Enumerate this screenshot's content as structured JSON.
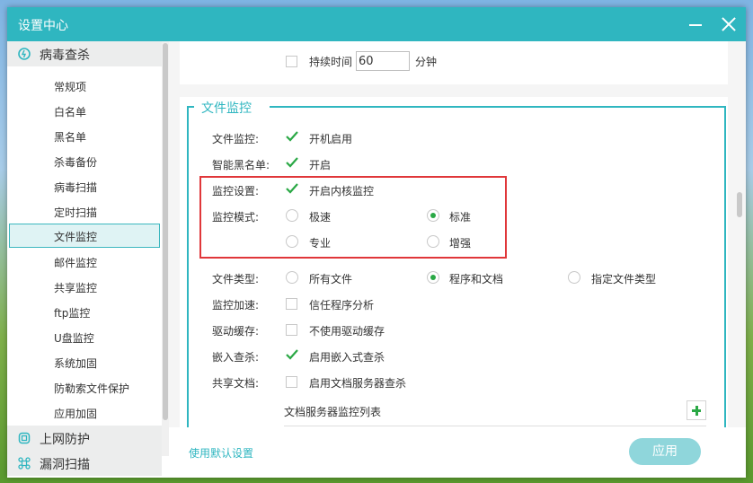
{
  "window": {
    "title": "设置中心"
  },
  "sidebar": {
    "categories": [
      {
        "label": "病毒查杀",
        "icon": "virus-scan-icon"
      },
      {
        "label": "上网防护",
        "icon": "web-protection-icon"
      },
      {
        "label": "漏洞扫描",
        "icon": "vulnerability-scan-icon"
      }
    ],
    "items": [
      "常规项",
      "白名单",
      "黑名单",
      "杀毒备份",
      "病毒扫描",
      "定时扫描",
      "文件监控",
      "邮件监控",
      "共享监控",
      "ftp监控",
      "U盘监控",
      "系统加固",
      "防勒索文件保护",
      "应用加固"
    ],
    "active_item": "文件监控"
  },
  "top_section": {
    "duration_label": "持续时间",
    "duration_value": "60",
    "duration_unit": "分钟"
  },
  "file_monitor": {
    "group_title": "文件监控",
    "file_monitor_label": "文件监控:",
    "file_monitor_option": "开机启用",
    "smart_blacklist_label": "智能黑名单:",
    "smart_blacklist_option": "开启",
    "monitor_setting_label": "监控设置:",
    "monitor_setting_option": "开启内核监控",
    "monitor_mode_label": "监控模式:",
    "monitor_modes": [
      "极速",
      "标准",
      "专业",
      "增强"
    ],
    "file_type_label": "文件类型:",
    "file_types": [
      "所有文件",
      "程序和文档",
      "指定文件类型"
    ],
    "accel_label": "监控加速:",
    "accel_option": "信任程序分析",
    "drive_cache_label": "驱动缓存:",
    "drive_cache_option": "不使用驱动缓存",
    "embedded_label": "嵌入查杀:",
    "embedded_option": "启用嵌入式查杀",
    "shared_docs_label": "共享文档:",
    "shared_docs_option": "启用文档服务器查杀",
    "server_list_title": "文档服务器监控列表"
  },
  "footer": {
    "default_settings": "使用默认设置",
    "apply": "应用"
  },
  "colors": {
    "accent": "#2fb6c0",
    "check_green": "#2aa845",
    "highlight_red": "#e0373a"
  }
}
